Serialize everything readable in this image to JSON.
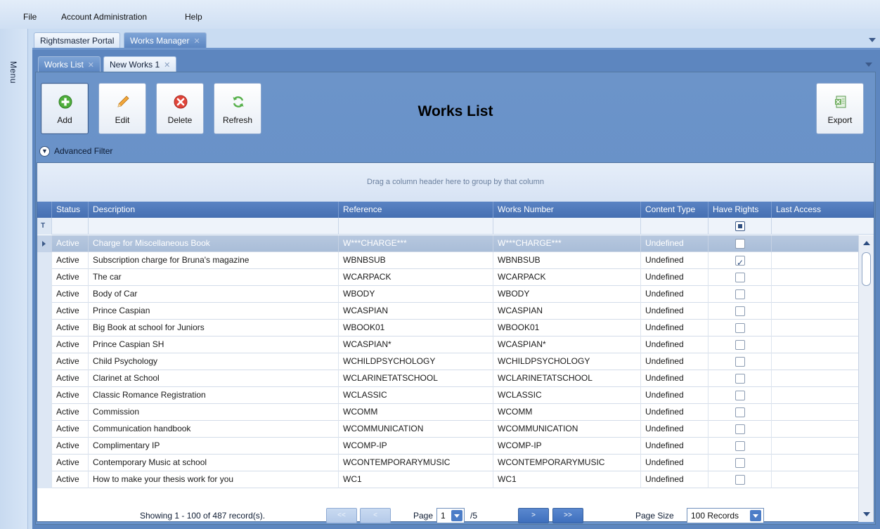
{
  "menu": {
    "items": [
      "File",
      "Account Administration",
      "Help"
    ]
  },
  "rail": {
    "label": "Menu"
  },
  "doc_tabs": [
    {
      "label": "Rightsmaster Portal",
      "active": false,
      "closable": false
    },
    {
      "label": "Works Manager",
      "active": true,
      "closable": true
    }
  ],
  "inner_tabs": [
    {
      "label": "Works List",
      "active": true,
      "closable": true
    },
    {
      "label": "New Works 1",
      "active": false,
      "closable": true
    }
  ],
  "toolbar": {
    "add_label": "Add",
    "edit_label": "Edit",
    "delete_label": "Delete",
    "refresh_label": "Refresh",
    "export_label": "Export",
    "title": "Works List",
    "advanced_filter": "Advanced Filter"
  },
  "grid": {
    "group_hint": "Drag a column header here to group by that column",
    "columns": [
      "Status",
      "Description",
      "Reference",
      "Works Number",
      "Content Type",
      "Have Rights",
      "Last Access"
    ],
    "rows": [
      {
        "status": "Active",
        "description": "Charge for Miscellaneous Book",
        "reference": "W***CHARGE***",
        "works_number": "W***CHARGE***",
        "content_type": "Undefined",
        "have_rights": false,
        "selected": true
      },
      {
        "status": "Active",
        "description": "Subscription charge for Bruna's magazine",
        "reference": "WBNBSUB",
        "works_number": "WBNBSUB",
        "content_type": "Undefined",
        "have_rights": true
      },
      {
        "status": "Active",
        "description": "The car",
        "reference": "WCARPACK",
        "works_number": "WCARPACK",
        "content_type": "Undefined",
        "have_rights": false
      },
      {
        "status": "Active",
        "description": "Body of Car",
        "reference": "WBODY",
        "works_number": "WBODY",
        "content_type": "Undefined",
        "have_rights": false
      },
      {
        "status": "Active",
        "description": "Prince Caspian",
        "reference": "WCASPIAN",
        "works_number": "WCASPIAN",
        "content_type": "Undefined",
        "have_rights": false
      },
      {
        "status": "Active",
        "description": "Big Book at school for Juniors",
        "reference": "WBOOK01",
        "works_number": "WBOOK01",
        "content_type": "Undefined",
        "have_rights": false
      },
      {
        "status": "Active",
        "description": "Prince Caspian SH",
        "reference": "WCASPIAN*",
        "works_number": "WCASPIAN*",
        "content_type": "Undefined",
        "have_rights": false
      },
      {
        "status": "Active",
        "description": "Child Psychology",
        "reference": "WCHILDPSYCHOLOGY",
        "works_number": "WCHILDPSYCHOLOGY",
        "content_type": "Undefined",
        "have_rights": false
      },
      {
        "status": "Active",
        "description": "Clarinet at School",
        "reference": "WCLARINETATSCHOOL",
        "works_number": "WCLARINETATSCHOOL",
        "content_type": "Undefined",
        "have_rights": false
      },
      {
        "status": "Active",
        "description": "Classic Romance Registration",
        "reference": "WCLASSIC",
        "works_number": "WCLASSIC",
        "content_type": "Undefined",
        "have_rights": false
      },
      {
        "status": "Active",
        "description": "Commission",
        "reference": "WCOMM",
        "works_number": "WCOMM",
        "content_type": "Undefined",
        "have_rights": false
      },
      {
        "status": "Active",
        "description": "Communication handbook",
        "reference": "WCOMMUNICATION",
        "works_number": "WCOMMUNICATION",
        "content_type": "Undefined",
        "have_rights": false
      },
      {
        "status": "Active",
        "description": "Complimentary IP",
        "reference": "WCOMP-IP",
        "works_number": "WCOMP-IP",
        "content_type": "Undefined",
        "have_rights": false
      },
      {
        "status": "Active",
        "description": "Contemporary Music at school",
        "reference": "WCONTEMPORARYMUSIC",
        "works_number": "WCONTEMPORARYMUSIC",
        "content_type": "Undefined",
        "have_rights": false
      },
      {
        "status": "Active",
        "description": "How to make your thesis work for you",
        "reference": "WC1",
        "works_number": "WC1",
        "content_type": "Undefined",
        "have_rights": false
      }
    ]
  },
  "pager": {
    "summary": "Showing 1 - 100 of 487 record(s).",
    "first_label": "<<",
    "prev_label": "<",
    "page_label": "Page",
    "current_page": "1",
    "total_pages": "/5",
    "next_label": ">",
    "last_label": ">>",
    "page_size_label": "Page Size",
    "page_size_value": "100 Records"
  },
  "colors": {
    "panel_blue": "#5d86bf",
    "header_blue": "#4a74b6",
    "selected_row": "#aec1db",
    "background": "#c9dcf2"
  },
  "icons": {
    "add": "plus-circle-icon",
    "edit": "pencil-icon",
    "delete": "x-circle-icon",
    "refresh": "refresh-icon",
    "export": "excel-icon"
  }
}
